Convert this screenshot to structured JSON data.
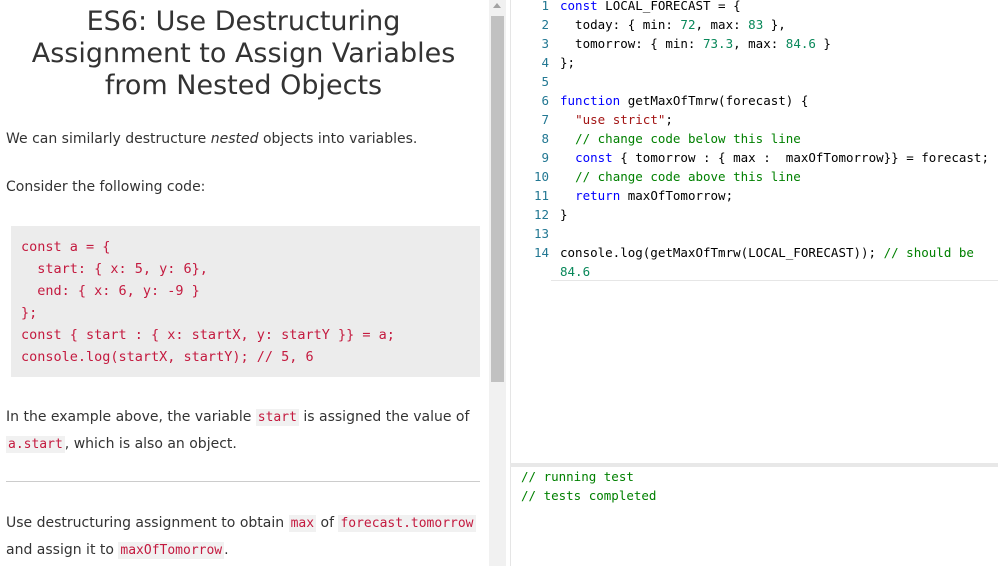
{
  "lesson": {
    "title": "ES6: Use Destructuring Assignment to Assign Variables from Nested Objects",
    "intro_before": "We can similarly destructure ",
    "intro_em": "nested",
    "intro_after": " objects into variables.",
    "consider": "Consider the following code:",
    "example_code": "const a = {\n  start: { x: 5, y: 6},\n  end: { x: 6, y: -9 }\n};\nconst { start : { x: startX, y: startY }} = a;\nconsole.log(startX, startY); // 5, 6",
    "explain_1": "In the example above, the variable ",
    "explain_code_1": "start",
    "explain_2": " is assigned the value of",
    "explain_code_2": "a.start",
    "explain_3": ", which is also an object.",
    "task_1": "Use destructuring assignment to obtain ",
    "task_code_1": "max",
    "task_2": " of ",
    "task_code_2": "forecast.tomorrow",
    "task_3": "and assign it to ",
    "task_code_3": "maxOfTomorrow",
    "task_4": "."
  },
  "editor": {
    "line_numbers": [
      "1",
      "2",
      "3",
      "4",
      "5",
      "6",
      "7",
      "8",
      "9",
      "10",
      "11",
      "12",
      "13",
      "14"
    ],
    "lines": {
      "l1": {
        "a": "const",
        "b": " LOCAL_FORECAST = {"
      },
      "l2": {
        "a": "  today: { min: ",
        "b": "72",
        "c": ", max: ",
        "d": "83",
        "e": " },"
      },
      "l3": {
        "a": "  tomorrow: { min: ",
        "b": "73.3",
        "c": ", max: ",
        "d": "84.6",
        "e": " }"
      },
      "l4": {
        "a": "};"
      },
      "l6": {
        "a": "function",
        "b": " getMaxOfTmrw(forecast) {"
      },
      "l7": {
        "a": "  ",
        "b": "\"use strict\"",
        "c": ";"
      },
      "l8": {
        "a": "  ",
        "b": "// change code below this line"
      },
      "l9": {
        "a": "  ",
        "b": "const",
        "c": " { tomorrow : { max :  maxOfTomorrow}} = forecast;"
      },
      "l10": {
        "a": "  ",
        "b": "// change code above this line"
      },
      "l11": {
        "a": "  ",
        "b": "return",
        "c": " maxOfTomorrow;"
      },
      "l12": {
        "a": "}"
      },
      "l14": {
        "a": "console.log(getMaxOfTmrw(LOCAL_FORECAST)); ",
        "b": "// should be"
      },
      "l14b": {
        "a": "84.6"
      }
    }
  },
  "output": {
    "lines": [
      "// running test",
      "// tests completed"
    ]
  },
  "colors": {
    "keyword": "#0000ff",
    "number": "#09885a",
    "string": "#a31515",
    "comment": "#008000",
    "line_number": "#237893",
    "inline_code": "#c41a3f"
  }
}
